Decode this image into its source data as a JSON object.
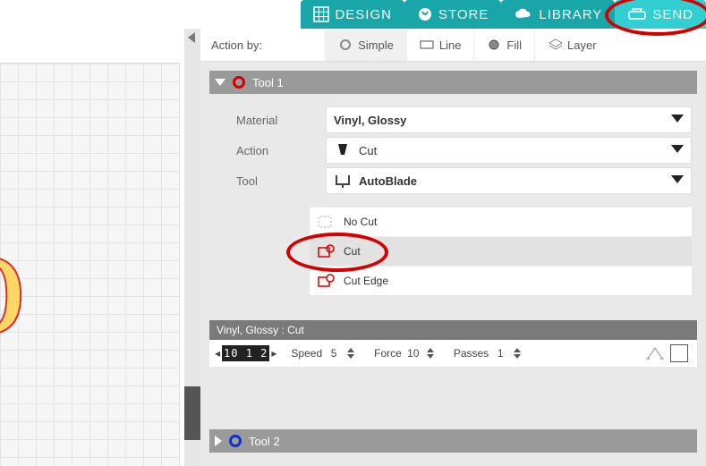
{
  "nav": {
    "design": "DESIGN",
    "store": "STORE",
    "library": "LIBRARY",
    "send": "SEND"
  },
  "action_by": {
    "label": "Action by:",
    "simple": "Simple",
    "line": "Line",
    "fill": "Fill",
    "layer": "Layer",
    "selected": "simple"
  },
  "tool1": {
    "title": "Tool 1",
    "color": "#d40000",
    "expanded": true,
    "material_label": "Material",
    "material_value": "Vinyl, Glossy",
    "action_label": "Action",
    "action_value": "Cut",
    "tool_label": "Tool",
    "tool_value": "AutoBlade",
    "cut_options": {
      "no_cut": "No Cut",
      "cut": "Cut",
      "cut_edge": "Cut Edge",
      "selected": "cut"
    },
    "settings": {
      "header": "Vinyl, Glossy : Cut",
      "blade_depth_display": "10 1 2",
      "speed_label": "Speed",
      "speed_value": "5",
      "force_label": "Force",
      "force_value": "10",
      "passes_label": "Passes",
      "passes_value": "1"
    }
  },
  "tool2": {
    "title": "Tool 2",
    "color": "#1030d0",
    "expanded": false
  },
  "canvas": {
    "sample_text": "o"
  }
}
